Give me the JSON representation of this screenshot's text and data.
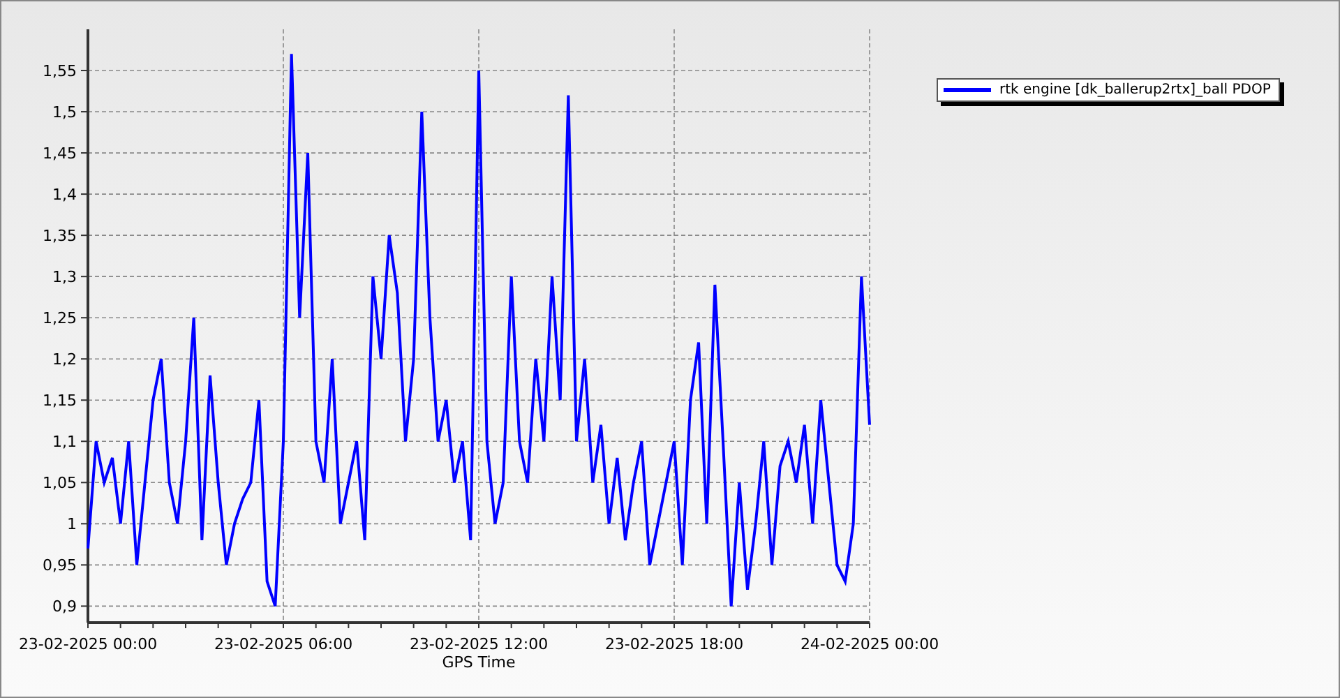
{
  "chart_data": {
    "type": "line",
    "grid": true,
    "xlabel": "GPS Time",
    "ylim": [
      0.88,
      1.6
    ],
    "yticks": [
      {
        "value": 0.9,
        "label": "0,9"
      },
      {
        "value": 0.95,
        "label": "0,95"
      },
      {
        "value": 1,
        "label": "1"
      },
      {
        "value": 1.05,
        "label": "1,05"
      },
      {
        "value": 1.1,
        "label": "1,1"
      },
      {
        "value": 1.15,
        "label": "1,15"
      },
      {
        "value": 1.2,
        "label": "1,2"
      },
      {
        "value": 1.25,
        "label": "1,25"
      },
      {
        "value": 1.3,
        "label": "1,3"
      },
      {
        "value": 1.35,
        "label": "1,35"
      },
      {
        "value": 1.4,
        "label": "1,4"
      },
      {
        "value": 1.45,
        "label": "1,45"
      },
      {
        "value": 1.5,
        "label": "1,5"
      },
      {
        "value": 1.55,
        "label": "1,55"
      }
    ],
    "categories": [
      "23-02-2025 00:00",
      null,
      null,
      null,
      null,
      null,
      null,
      null,
      null,
      null,
      null,
      null,
      null,
      null,
      null,
      null,
      null,
      null,
      null,
      null,
      null,
      null,
      null,
      null,
      "23-02-2025 06:00",
      null,
      null,
      null,
      null,
      null,
      null,
      null,
      null,
      null,
      null,
      null,
      null,
      null,
      null,
      null,
      null,
      null,
      null,
      null,
      null,
      null,
      null,
      null,
      "23-02-2025 12:00",
      null,
      null,
      null,
      null,
      null,
      null,
      null,
      null,
      null,
      null,
      null,
      null,
      null,
      null,
      null,
      null,
      null,
      null,
      null,
      null,
      null,
      null,
      null,
      "23-02-2025 18:00",
      null,
      null,
      null,
      null,
      null,
      null,
      null,
      null,
      null,
      null,
      null,
      null,
      null,
      null,
      null,
      null,
      null,
      null,
      null,
      null,
      null,
      null,
      null,
      "24-02-2025 00:00"
    ],
    "series": [
      {
        "name": "rtk engine [dk_ballerup2rtx]_ball PDOP",
        "color": "#0000ff",
        "values": [
          0.97,
          1.1,
          1.05,
          1.08,
          1.0,
          1.1,
          0.95,
          1.05,
          1.15,
          1.2,
          1.05,
          1.0,
          1.1,
          1.25,
          0.98,
          1.18,
          1.05,
          0.95,
          1.0,
          1.03,
          1.05,
          1.15,
          0.93,
          0.9,
          1.1,
          1.57,
          1.25,
          1.45,
          1.1,
          1.05,
          1.2,
          1.0,
          1.05,
          1.1,
          0.98,
          1.3,
          1.2,
          1.35,
          1.28,
          1.1,
          1.2,
          1.5,
          1.25,
          1.1,
          1.15,
          1.05,
          1.1,
          0.98,
          1.55,
          1.1,
          1.0,
          1.05,
          1.3,
          1.1,
          1.05,
          1.2,
          1.1,
          1.3,
          1.15,
          1.52,
          1.1,
          1.2,
          1.05,
          1.12,
          1.0,
          1.08,
          0.98,
          1.05,
          1.1,
          0.95,
          1.0,
          1.05,
          1.1,
          0.95,
          1.15,
          1.22,
          1.0,
          1.29,
          1.1,
          0.9,
          1.05,
          0.92,
          1.0,
          1.1,
          0.95,
          1.07,
          1.1,
          1.05,
          1.12,
          1.0,
          1.15,
          1.05,
          0.95,
          0.93,
          1.0,
          1.3,
          1.12
        ]
      }
    ]
  }
}
